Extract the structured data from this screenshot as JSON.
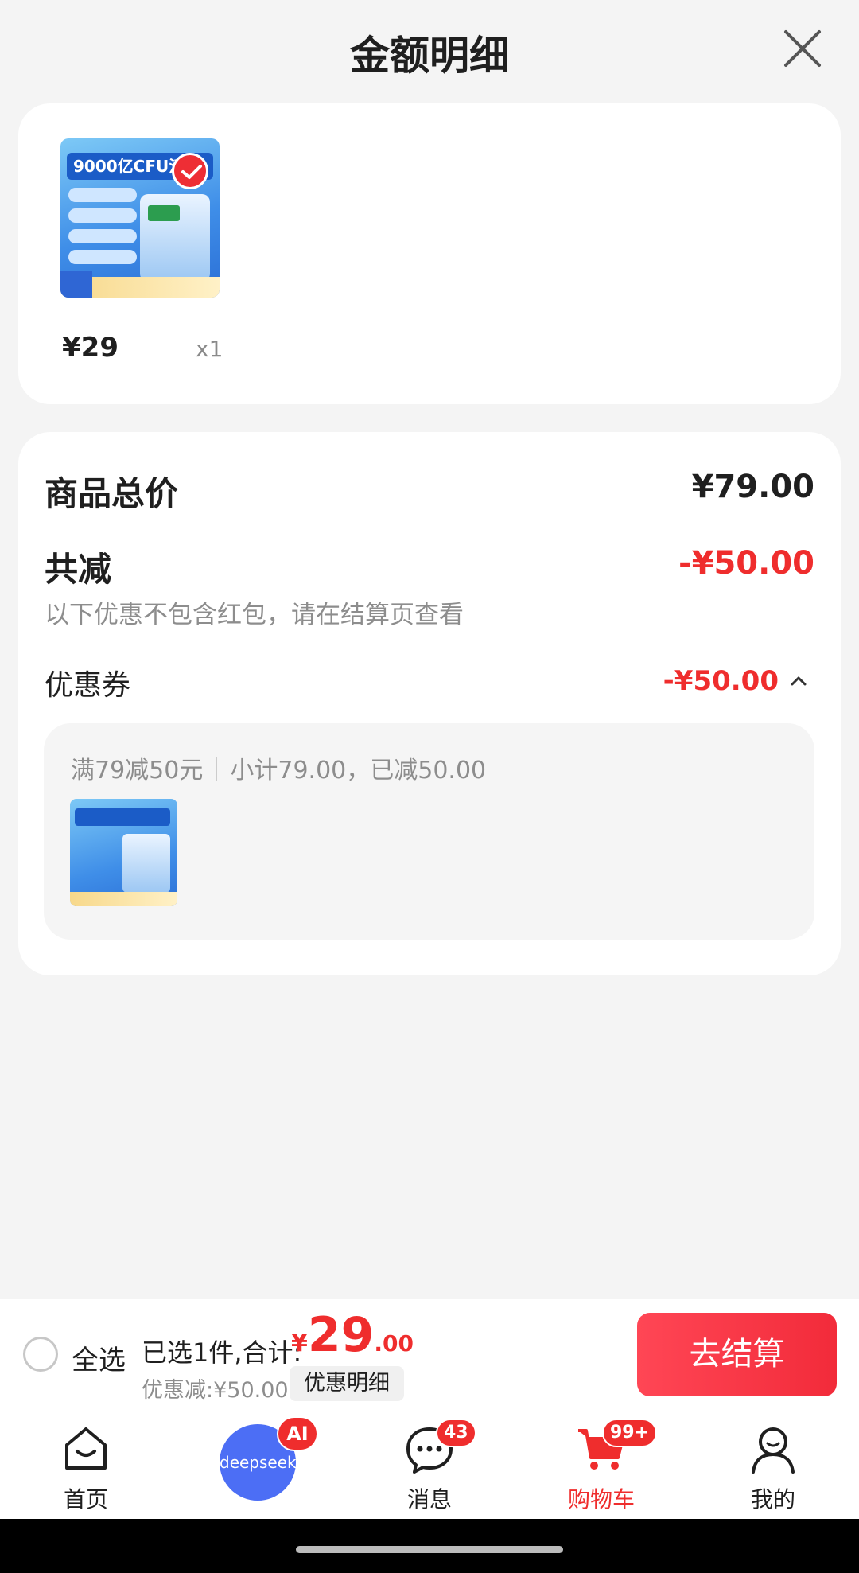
{
  "sheet": {
    "title": "金额明细"
  },
  "product": {
    "price": "¥29",
    "quantity": "x1",
    "thumb_headline": "9000亿CFU活菌"
  },
  "summary": {
    "total_label": "商品总价",
    "total_value": "¥79.00",
    "reduce_label": "共减",
    "reduce_value": "-¥50.00",
    "reduce_note": "以下优惠不包含红包，请在结算页查看",
    "coupon_label": "优惠券",
    "coupon_value": "-¥50.00",
    "coupon_rule": "满79减50元",
    "coupon_subtotal": "小计79.00，已减50.00"
  },
  "checkout": {
    "select_all": "全选",
    "selected_text": "已选1件,合计:",
    "currency": "¥",
    "total_int": "29",
    "total_dec": ".00",
    "discount_text": "优惠减:¥50.00",
    "detail_chip": "优惠明细",
    "button": "去结算"
  },
  "tabbar": {
    "items": [
      {
        "label": "首页",
        "icon": "home-icon"
      },
      {
        "label": "deepseek",
        "icon": "deepseek-icon",
        "badge": "AI"
      },
      {
        "label": "消息",
        "icon": "message-icon",
        "badge": "43"
      },
      {
        "label": "购物车",
        "icon": "cart-icon",
        "badge": "99+",
        "active": true
      },
      {
        "label": "我的",
        "icon": "profile-icon"
      }
    ]
  },
  "colors": {
    "accent": "#ef2d2d",
    "brand_blue": "#4c6ef5"
  }
}
